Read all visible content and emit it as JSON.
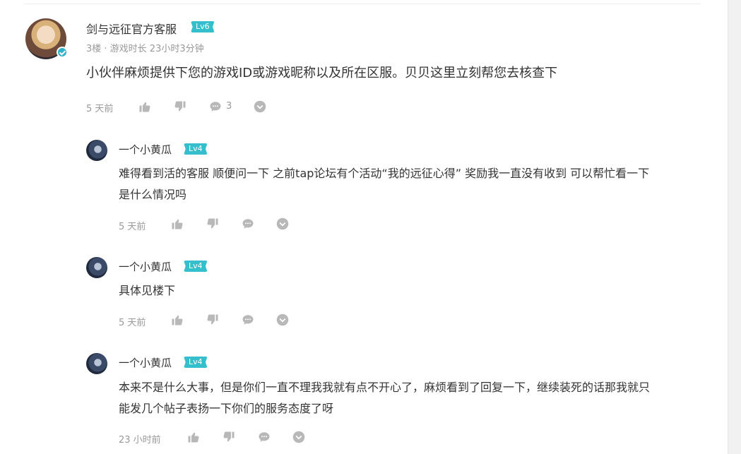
{
  "main_comment": {
    "author": "剑与远征官方客服",
    "level": "Lv6",
    "meta": "3楼 · 游戏时长 23小时3分钟",
    "text": "小伙伴麻烦提供下您的游戏ID或游戏昵称以及所在区服。贝贝这里立刻帮您去核查下",
    "time": "5 天前",
    "reply_count": "3"
  },
  "replies": [
    {
      "author": "一个小黄瓜",
      "level": "Lv4",
      "text_line1": "难得看到活的客服 顺便问一下 之前tap论坛有个活动“我的远征心得” 奖励我一直没有收到 可以帮忙看一下",
      "text_line2": "是什么情况吗",
      "time": "5 天前"
    },
    {
      "author": "一个小黄瓜",
      "level": "Lv4",
      "text_line1": "具体见楼下",
      "time": "5 天前"
    },
    {
      "author": "一个小黄瓜",
      "level": "Lv4",
      "text_line1": "本来不是什么大事，但是你们一直不理我我就有点不开心了，麻烦看到了回复一下，继续装死的话那我就只",
      "text_line2": "能发几个帖子表扬一下你们的服务态度了呀",
      "time": "23 小时前"
    }
  ],
  "colors": {
    "level_badge": "#35bfcd",
    "verified": "#2fb3c9",
    "muted_text": "#999999"
  }
}
